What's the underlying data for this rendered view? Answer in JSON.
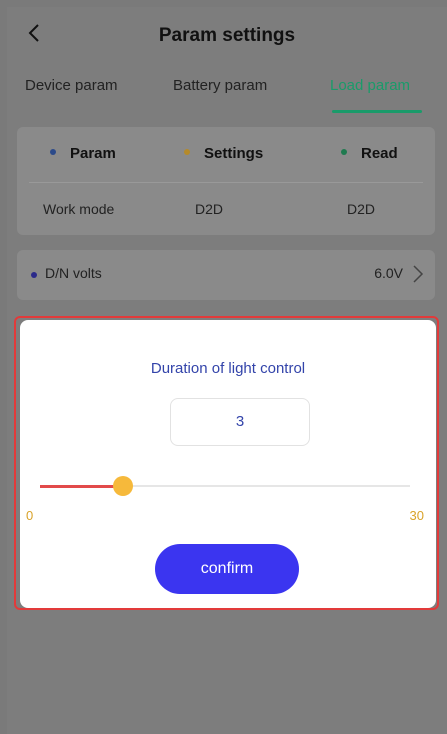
{
  "header": {
    "title": "Param settings",
    "back_icon": "chevron-left-icon"
  },
  "tabs": [
    {
      "label": "Device param",
      "active": false
    },
    {
      "label": "Battery param",
      "active": false
    },
    {
      "label": "Load param",
      "active": true
    }
  ],
  "table": {
    "columns": [
      {
        "label": "Param",
        "dot_color": "#2b4a8a"
      },
      {
        "label": "Settings",
        "dot_color": "#b58a2a"
      },
      {
        "label": "Read",
        "dot_color": "#1f7a4f"
      }
    ],
    "row": {
      "param": "Work mode",
      "setting": "D2D",
      "read": "D2D"
    }
  },
  "volts": {
    "label": "D/N volts",
    "value": "6.0V",
    "dot_color": "#2b2a8a",
    "chevron_icon": "chevron-right-icon"
  },
  "dialog": {
    "title": "Duration of light control",
    "value": "3",
    "slider": {
      "min": "0",
      "max": "30",
      "current": 3
    },
    "confirm_label": "confirm"
  },
  "colors": {
    "accent": "#1a9b6a",
    "button": "#3b35f0",
    "slider_fill": "#e24a4a",
    "knob": "#f6b93b",
    "highlight_border": "#e23a3a"
  }
}
